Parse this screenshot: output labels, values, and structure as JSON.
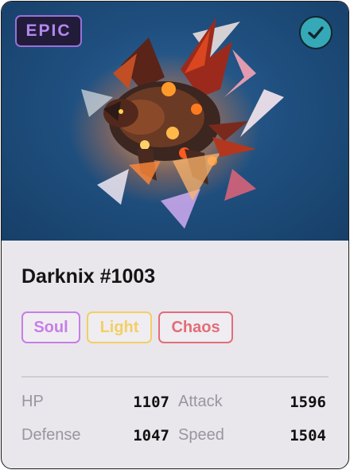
{
  "card": {
    "rarity": "EPIC",
    "name": "Darknix #1003",
    "tags": [
      {
        "label": "Soul",
        "color": "#c77ee8"
      },
      {
        "label": "Light",
        "color": "#f3cf63"
      },
      {
        "label": "Chaos",
        "color": "#e26d78"
      }
    ],
    "stats": [
      {
        "label": "HP",
        "value": "1107"
      },
      {
        "label": "Attack",
        "value": "1596"
      },
      {
        "label": "Defense",
        "value": "1047"
      },
      {
        "label": "Speed",
        "value": "1504"
      }
    ],
    "verified_icon": "checkmark-icon",
    "colors": {
      "rarity": "#b488f0",
      "check": "#35a9b7",
      "art_bg": "#1f4f7f"
    }
  }
}
